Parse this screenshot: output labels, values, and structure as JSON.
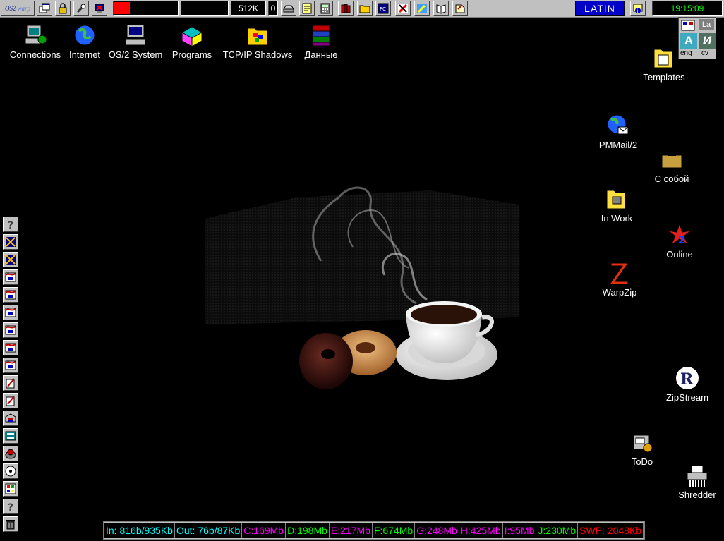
{
  "topbar": {
    "logo": "OS2",
    "mem_value": "512K",
    "counter": "0",
    "layout_label": "LATIN",
    "time": "19:15:09",
    "meter_fraction": 0.25
  },
  "langbox": {
    "la": "La",
    "a_label": "A",
    "i_label": "И",
    "eng": "eng",
    "cv": "cv"
  },
  "desktop_top": [
    {
      "label": "Connections"
    },
    {
      "label": "Internet"
    },
    {
      "label": "OS/2 System"
    },
    {
      "label": "Programs"
    },
    {
      "label": "TCP/IP Shadows"
    },
    {
      "label": "Данные"
    }
  ],
  "desktop_right": [
    {
      "label": "Templates"
    },
    {
      "label": "PMMail/2"
    },
    {
      "label": "С собой"
    },
    {
      "label": "In Work"
    },
    {
      "label": "Online"
    },
    {
      "label": "WarpZip"
    },
    {
      "label": "ZipStream"
    },
    {
      "label": "ToDo"
    },
    {
      "label": "Shredder"
    }
  ],
  "status": [
    {
      "text": "In: 816b/935Kb",
      "color": "#00ffff"
    },
    {
      "text": "Out: 76b/87Kb",
      "color": "#00ffff"
    },
    {
      "text": "C:169Mb",
      "color": "#ff00ff"
    },
    {
      "text": "D:198Mb",
      "color": "#00ff00"
    },
    {
      "text": "E:217Mb",
      "color": "#ff00ff"
    },
    {
      "text": "F:674Mb",
      "color": "#00ff00"
    },
    {
      "text": "G:248Mb",
      "color": "#ff00ff"
    },
    {
      "text": "H:425Mb",
      "color": "#ff00ff"
    },
    {
      "text": "I:95Mb",
      "color": "#ff00ff"
    },
    {
      "text": "J:230Mb",
      "color": "#00ff00"
    },
    {
      "text": "SWP: 2048Kb",
      "color": "#ff0000"
    }
  ],
  "icons": {
    "left_launcher": [
      "help-icon",
      "tools-icon",
      "tools-icon",
      "window-icon",
      "window-icon",
      "window-icon",
      "window-icon",
      "window-icon",
      "window-icon",
      "edit-icon",
      "edit-icon",
      "folder-icon",
      "monitor-icon",
      "globe-icon",
      "cd-icon",
      "palette-icon",
      "help-icon",
      "trash-icon"
    ]
  }
}
